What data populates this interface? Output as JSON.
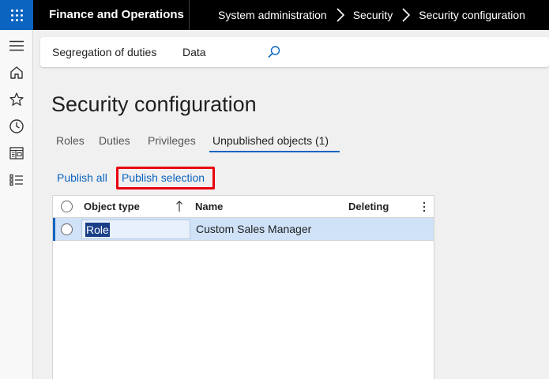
{
  "topbar": {
    "app_title": "Finance and Operations",
    "breadcrumb": [
      "System administration",
      "Security",
      "Security configuration"
    ]
  },
  "leftnav": {
    "icons": [
      "hamburger-icon",
      "home-icon",
      "star-icon",
      "clock-icon",
      "workspace-icon",
      "list-icon"
    ]
  },
  "actionpane": {
    "items": [
      "Segregation of duties",
      "Data"
    ],
    "search_icon": "search-icon"
  },
  "page": {
    "title": "Security configuration",
    "tabs": [
      "Roles",
      "Duties",
      "Privileges",
      "Unpublished objects (1)"
    ],
    "active_tab": "Unpublished objects (1)",
    "actions": {
      "publish_all": "Publish all",
      "publish_selection": "Publish selection"
    }
  },
  "grid": {
    "columns": [
      "Object type",
      "Name",
      "Deleting"
    ],
    "rows": [
      {
        "object_type": "Role",
        "name": "Custom Sales Manager",
        "deleting": ""
      }
    ]
  },
  "colors": {
    "accent": "#0b64c0",
    "highlight": "#e8000f",
    "selected_row": "#cfe2f8"
  }
}
